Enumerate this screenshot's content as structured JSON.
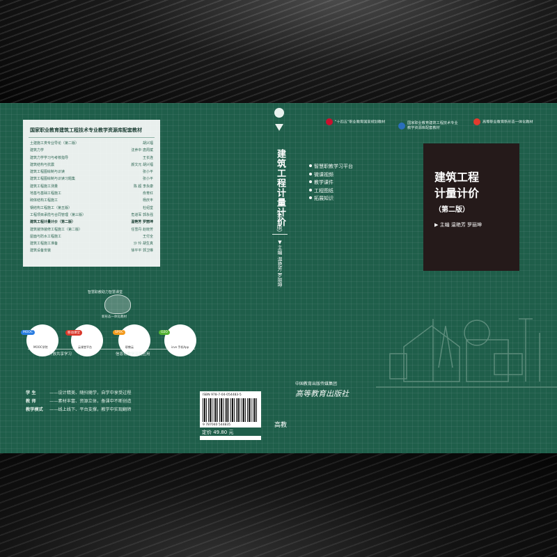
{
  "series": {
    "title": "国家职业教育建筑工程技术专业教学资源库配套教材",
    "books": [
      {
        "title": "土建施工类专业导论（第二版）",
        "author": "胡兴福"
      },
      {
        "title": "建筑力学",
        "author": "沈养中  唐周斌"
      },
      {
        "title": "建筑力学学习与考核指导",
        "author": "王长连"
      },
      {
        "title": "建筑结构与抗震",
        "author": "颜文元  胡兴福"
      },
      {
        "title": "建筑工程图绘制与识读",
        "author": "张小平"
      },
      {
        "title": "建筑工程图绘制与识读习题集",
        "author": "张小平"
      },
      {
        "title": "建筑工程施工测量",
        "author": "陈  超  李永康"
      },
      {
        "title": "地基与基础工程施工",
        "author": "俞育红"
      },
      {
        "title": "砌体结构工程施工",
        "author": "杨庆丰"
      },
      {
        "title": "钢结构工程施工（第五版）",
        "author": "杜绍堂"
      },
      {
        "title": "工程项目承揽与合同管理（第三版）",
        "author": "危道军  郭永强"
      },
      {
        "title": "建筑工程计量计价（第二版）",
        "author": "温艳芳  罗丽坤"
      },
      {
        "title": "建筑装饰装修工程施工（第二版）",
        "author": "任雪丹  赵晓芳"
      },
      {
        "title": "屋面与防水工程施工",
        "author": "王付全"
      },
      {
        "title": "建筑工程施工准备",
        "author": "沙  玲  胡生真"
      },
      {
        "title": "建筑设备安装",
        "author": "徐平平  郭卫琳"
      }
    ],
    "current_index": 11
  },
  "diagram": {
    "arc_label": "智慧职教助力智慧课堂",
    "sub_label": "新形态一体化教材",
    "nodes": [
      {
        "tag": "MOOC",
        "chip": "MOOC学院",
        "color": "#2a7de1"
      },
      {
        "tag": "移动课堂",
        "chip": "云课堂平台",
        "color": "#d9372a"
      },
      {
        "tag": "SPOC",
        "chip": "职教云",
        "color": "#f39a1c"
      },
      {
        "tag": "O2O",
        "chip": "icve 手机App",
        "color": "#55b233"
      }
    ],
    "left_caption": "开放共享学习",
    "right_caption": "信息化教学深度应用"
  },
  "taglines": [
    {
      "who": "学    生",
      "text": "——设计精美、随扫随学，自学中享受过程"
    },
    {
      "who": "教    师",
      "text": "——素材丰富、资源立体，备课中不断创造"
    },
    {
      "who": "教学模式",
      "text": "——线上线下、平台支撑，教学中实现翻转"
    }
  ],
  "spine": {
    "title": "建筑工程计量计价",
    "edition": "（第二版）",
    "author_prefix": "▼主编",
    "authors": "温艳芳  罗丽坤",
    "publisher_mark": "高教"
  },
  "features": [
    "智慧职教学习平台",
    "微课视频",
    "教学课件",
    "工程图纸",
    "拓展知识"
  ],
  "badges": [
    {
      "text": "\"十四五\"职业教育国家规划教材",
      "color": "#c8102e"
    },
    {
      "text": "国家职业教育建筑工程技术专业\n教学资源库配套教材",
      "color": "#2a6ebb"
    },
    {
      "text": "高等职业教育新形态一体化教材",
      "color": "#e23b2e"
    }
  ],
  "cover": {
    "title_line1": "建筑工程",
    "title_line2": "计量计价",
    "edition": "（第二版）",
    "author_line": "▶ 主编    温艳芳    罗丽坤"
  },
  "publisher": {
    "group": "中国教育出版传媒集团",
    "name": "高等教育出版社"
  },
  "isbn": {
    "text": "ISBN 978-7-04-054483-5",
    "digits": "9 787040 544835",
    "price": "定价 49.80 元"
  }
}
